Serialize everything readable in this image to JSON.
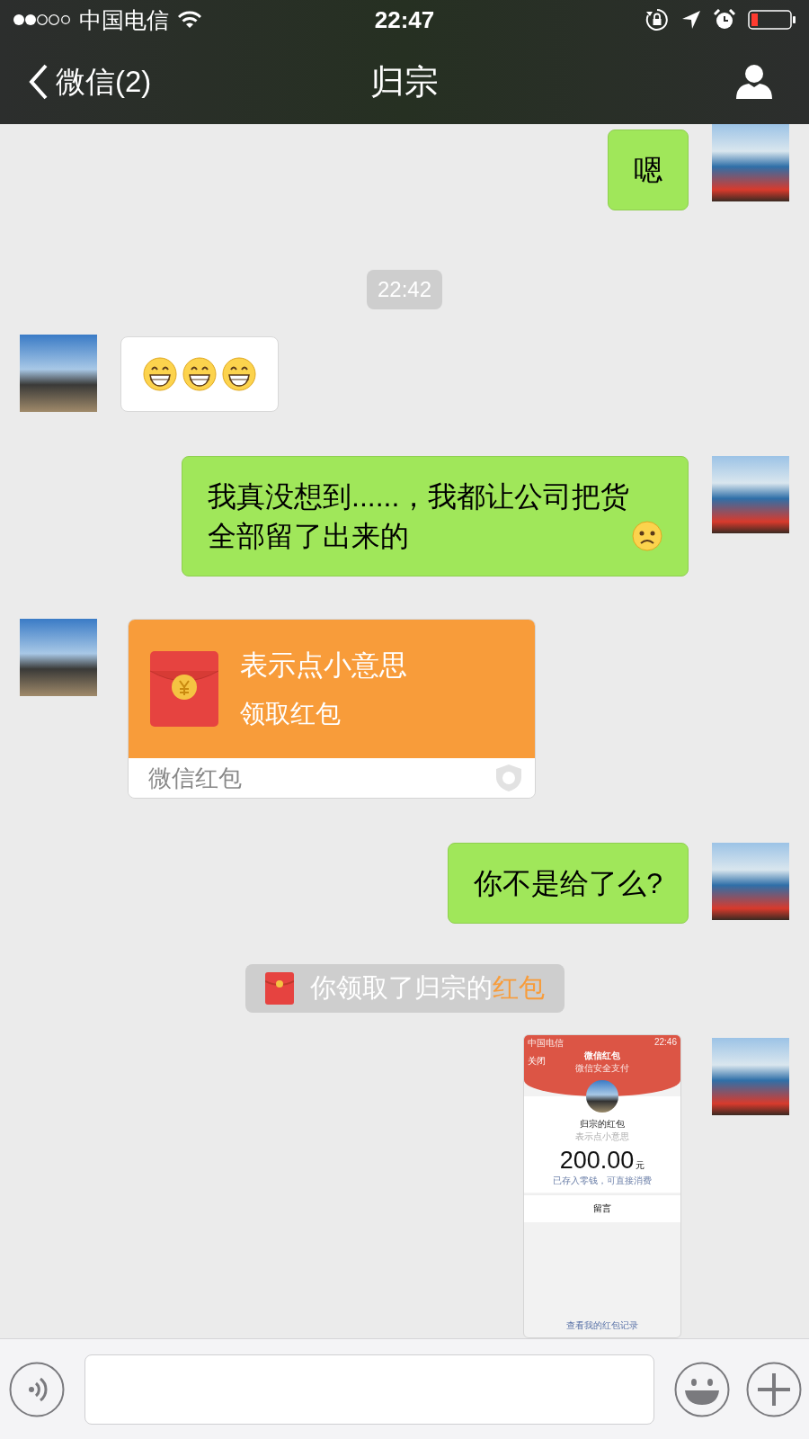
{
  "status_bar": {
    "carrier": "中国电信",
    "time": "22:47"
  },
  "nav": {
    "back": "微信(2)",
    "title": "归宗"
  },
  "messages": [
    {
      "kind": "text",
      "outgoing": true,
      "text": "嗯",
      "emoji_after": false
    },
    {
      "kind": "time",
      "text": "22:42"
    },
    {
      "kind": "emoji",
      "outgoing": false
    },
    {
      "kind": "text",
      "outgoing": true,
      "text": "我真没想到......，我都让公司把货全部留了出来的",
      "emoji_after": true
    },
    {
      "kind": "red_packet",
      "outgoing": false,
      "greeting": "表示点小意思",
      "action": "领取红包",
      "footer": "微信红包"
    },
    {
      "kind": "text",
      "outgoing": true,
      "text": "你不是给了么?",
      "emoji_after": false
    },
    {
      "kind": "notice",
      "text": "你领取了归宗的",
      "link": "红包"
    },
    {
      "kind": "screenshot",
      "outgoing": true,
      "screen": {
        "carrier": "中国电信",
        "time": "22:46",
        "close": "关闭",
        "title": "微信红包",
        "subtitle": "微信安全支付",
        "sender": "归宗的红包",
        "greeting": "表示点小意思",
        "amount": "200.00",
        "unit": "元",
        "note": "已存入零钱，可直接消费",
        "message": "留言",
        "history": "查看我的红包记录"
      }
    }
  ]
}
